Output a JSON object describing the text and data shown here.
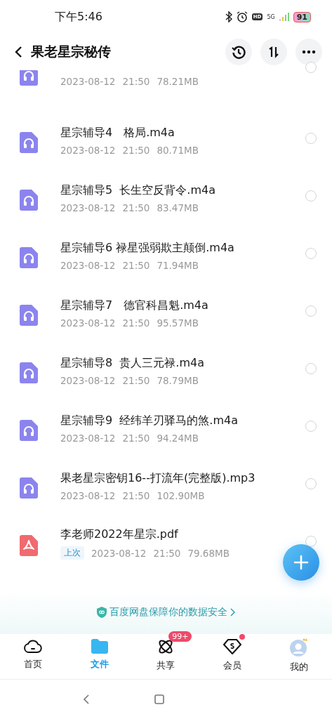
{
  "status_bar": {
    "time": "下午5:46",
    "hd": "HD",
    "network": "5G",
    "battery": "91"
  },
  "header": {
    "title": "果老星宗秘传"
  },
  "files": [
    {
      "kind": "audio",
      "date": "2023-08-12",
      "time": "21:50",
      "size": "78.21MB",
      "checked": false
    },
    {
      "kind": "audio",
      "name": "星宗辅导4　格局.m4a",
      "date": "2023-08-12",
      "time": "21:50",
      "size": "80.71MB",
      "checked": false
    },
    {
      "kind": "audio",
      "name": "星宗辅导5  长生空反背令.m4a",
      "date": "2023-08-12",
      "time": "21:50",
      "size": "83.47MB",
      "checked": false
    },
    {
      "kind": "audio",
      "name": "星宗辅导6 禄星强弱欺主颠倒.m4a",
      "date": "2023-08-12",
      "time": "21:50",
      "size": "71.94MB",
      "checked": false
    },
    {
      "kind": "audio",
      "name": "星宗辅导7　德官科昌魁.m4a",
      "date": "2023-08-12",
      "time": "21:50",
      "size": "95.57MB",
      "checked": false
    },
    {
      "kind": "audio",
      "name": "星宗辅导8  贵人三元禄.m4a",
      "date": "2023-08-12",
      "time": "21:50",
      "size": "78.79MB",
      "checked": false
    },
    {
      "kind": "audio",
      "name": "星宗辅导9  经纬羊刃驿马的煞.m4a",
      "date": "2023-08-12",
      "time": "21:50",
      "size": "94.24MB",
      "checked": false
    },
    {
      "kind": "audio",
      "name": "果老星宗密钥16--打流年(完整版).mp3",
      "date": "2023-08-12",
      "time": "21:50",
      "size": "102.90MB",
      "checked": false
    },
    {
      "kind": "pdf",
      "name": "李老师2022年星宗.pdf",
      "badge": "上次",
      "date": "2023-08-12",
      "time": "21:50",
      "size": "79.68MB",
      "checked": false
    }
  ],
  "banner": {
    "text": "百度网盘保障你的数据安全"
  },
  "tabs": [
    {
      "kind": "home",
      "label": "首页",
      "selected": false,
      "dot": false
    },
    {
      "kind": "files",
      "label": "文件",
      "selected": true,
      "dot": false
    },
    {
      "kind": "share",
      "label": "共享",
      "selected": false,
      "badge": "99+",
      "dot": false
    },
    {
      "kind": "vip",
      "label": "会员",
      "selected": false,
      "dot": true
    },
    {
      "kind": "me",
      "label": "我的",
      "selected": false,
      "dot": false
    }
  ]
}
